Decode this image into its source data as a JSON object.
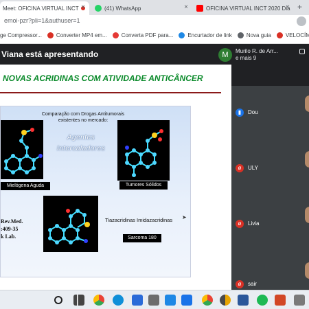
{
  "browser": {
    "tabs": [
      {
        "title": "Meet: OFICINA VIRTUAL INCT",
        "close": "×",
        "recording": true,
        "favicon_color": "#00897b"
      },
      {
        "title": "(41) WhatsApp",
        "close": "×",
        "favicon_color": "#25d366"
      },
      {
        "title": "OFICINA VIRTUAL INCT 2020 Dia",
        "close": "×",
        "favicon_color": "#ff0000"
      }
    ],
    "new_tab": "+",
    "address": "emoi-pzr?pli=1&authuser=1",
    "bookmarks": [
      {
        "label": "ge Compressor...",
        "color": "#ffffff"
      },
      {
        "label": "Converter MP4 em...",
        "color": "#d93025"
      },
      {
        "label": "Converta PDF para...",
        "color": "#e53935"
      },
      {
        "label": "Encurtador de link",
        "color": "#1e88e5"
      },
      {
        "label": "Nova guia",
        "color": "#5f6368"
      },
      {
        "label": "VELOCÍM",
        "color": "#d93025"
      }
    ]
  },
  "meet": {
    "presenting_text": "Viana está apresentando",
    "presenter": {
      "initial": "M",
      "name_line1": "Murilo R. de Arr...",
      "name_line2": "e mais 9"
    },
    "participants": [
      {
        "name": "Dou",
        "mic": "on",
        "icon": "mic-on-icon"
      },
      {
        "name": "ULY",
        "mic": "off",
        "icon": "mic-off-icon"
      },
      {
        "name": "Livia",
        "mic": "off",
        "icon": "mic-off-icon"
      },
      {
        "name": "sair",
        "mic": "off",
        "icon": "mic-off-icon"
      }
    ]
  },
  "slide": {
    "title": "NOVAS ACRIDINAS COM ATIVIDADE ANTICÂNCER",
    "panel_heading_line1": "Comparação com Drogas Antitumorais",
    "panel_heading_line2": "existentes no mercado:",
    "agents_line1": "Agentes",
    "agents_line2": "Intercaladores",
    "label_1": "Mielógena Aguda",
    "label_2": "Tumores Sólidos",
    "label_3": "Sarcoma 180",
    "reference_line1": "Rev.Med.",
    "reference_line2": ":409-35",
    "reference_line3": "k Lab.",
    "tiazacridines": "Tiazacridinas Imidazacridinas"
  },
  "colors": {
    "slide_title": "#0a8a2a",
    "slide_rule": "#8b1a1a",
    "meet_bg": "#202124",
    "tile_bg": "#3c4043",
    "mic_off": "#d93025",
    "mic_on": "#1a73e8"
  },
  "taskbar": {
    "icons": [
      "windows-search-icon",
      "task-view-icon",
      "chrome-icon",
      "edge-icon",
      "store-icon",
      "mail-icon",
      "photos-icon",
      "chrome-canary-icon",
      "word-icon",
      "spotify-icon",
      "powerpoint-icon",
      "settings-icon"
    ]
  }
}
